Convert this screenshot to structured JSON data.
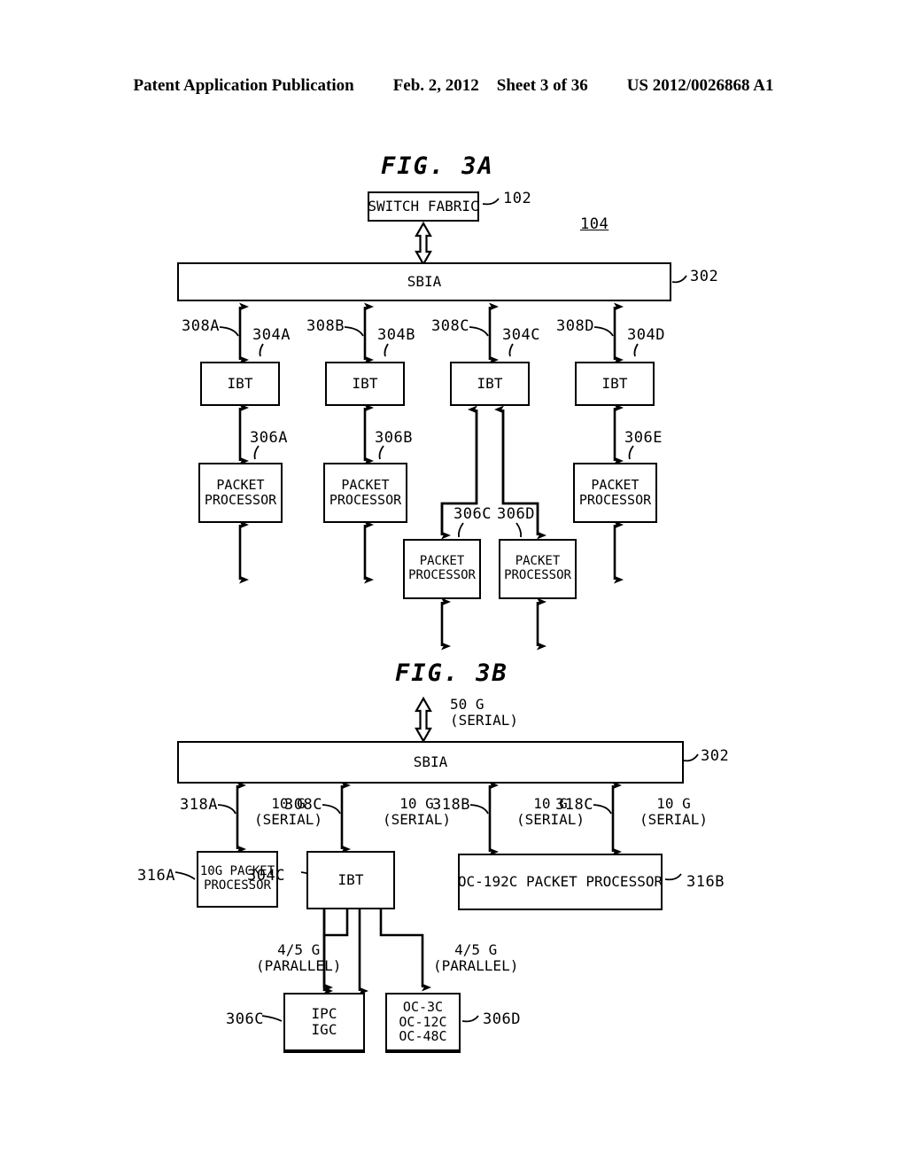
{
  "header": {
    "publication": "Patent Application Publication",
    "date": "Feb. 2, 2012",
    "sheet": "Sheet 3 of 36",
    "patent_number": "US 2012/0026868 A1"
  },
  "fig3a": {
    "title": "FIG. 3A",
    "switch_fabric": {
      "label": "SWITCH FABRIC",
      "ref": "102"
    },
    "system_ref": "104",
    "sbia": {
      "label": "SBIA",
      "ref": "302"
    },
    "ibt_label": "IBT",
    "ibts": [
      {
        "ref": "304A",
        "uplink_ref": "308A"
      },
      {
        "ref": "304B",
        "uplink_ref": "308B"
      },
      {
        "ref": "304C",
        "uplink_ref": "308C"
      },
      {
        "ref": "304D",
        "uplink_ref": "308D"
      }
    ],
    "packet_processor_line1": "PACKET",
    "packet_processor_line2": "PROCESSOR",
    "packet_processors": [
      {
        "ref": "306A"
      },
      {
        "ref": "306B"
      },
      {
        "ref": "306C"
      },
      {
        "ref": "306D"
      },
      {
        "ref": "306E"
      }
    ]
  },
  "fig3b": {
    "title": "FIG. 3B",
    "uplink": {
      "rate_line1": "50 G",
      "rate_line2": "(SERIAL)"
    },
    "sbia": {
      "label": "SBIA",
      "ref": "302"
    },
    "links": [
      {
        "ref": "318A",
        "rate_line1": "10 G",
        "rate_line2": "(SERIAL)"
      },
      {
        "ref": "308C",
        "rate_line1": "10 G",
        "rate_line2": "(SERIAL)"
      },
      {
        "ref": "318B",
        "rate_line1": "10 G",
        "rate_line2": "(SERIAL)"
      },
      {
        "ref": "318C",
        "rate_line1": "10 G",
        "rate_line2": "(SERIAL)"
      }
    ],
    "pp10g": {
      "line1": "10G PACKET",
      "line2": "PROCESSOR",
      "ref": "316A"
    },
    "ibt": {
      "label": "IBT",
      "ref": "304C"
    },
    "oc192c": {
      "label": "OC-192C PACKET PROCESSOR",
      "ref": "316B"
    },
    "parallel_links": [
      {
        "rate_line1": "4/5 G",
        "rate_line2": "(PARALLEL)"
      },
      {
        "rate_line1": "4/5 G",
        "rate_line2": "(PARALLEL)"
      }
    ],
    "ipc_igc": {
      "line1": "IPC",
      "line2": "IGC",
      "ref": "306C"
    },
    "oc_rates": {
      "line1": "OC-3C",
      "line2": "OC-12C",
      "line3": "OC-48C",
      "ref": "306D"
    }
  }
}
